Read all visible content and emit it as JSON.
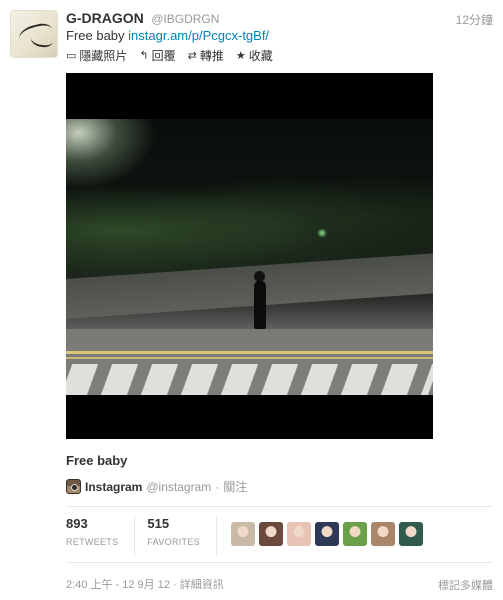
{
  "tweet": {
    "fullname": "G-DRAGON",
    "screenname": "@IBGDRGN",
    "time": "12分鐘",
    "text_plain": "Free baby ",
    "text_link": "instagr.am/p/Pcgcx-tgBf/"
  },
  "actions": [
    {
      "icon": "photo-icon",
      "label": "隱藏照片"
    },
    {
      "icon": "reply-icon",
      "label": "回覆"
    },
    {
      "icon": "retweet-icon",
      "label": "轉推"
    },
    {
      "icon": "star-icon",
      "label": "收藏"
    }
  ],
  "media": {
    "caption": "Free baby",
    "provider_name": "Instagram",
    "provider_handle": "@instagram",
    "separator": "·",
    "follow_label": "關注"
  },
  "stats": {
    "retweets_count": "893",
    "retweets_label": "RETWEETS",
    "favorites_count": "515",
    "favorites_label": "FAVORITES"
  },
  "favoriters": [
    "#c9b9a7",
    "#6b4a3d",
    "#e7c2b5",
    "#2e3a55",
    "#6aa04a",
    "#a9866a",
    "#2f5c4c"
  ],
  "footer": {
    "timestamp": "2:40 上午 - 12 9月 12",
    "details_link": "詳細資訊",
    "flag_media": "標記多媒體"
  },
  "colors": {
    "link": "#0084b4",
    "muted": "#999999",
    "text": "#333333"
  }
}
